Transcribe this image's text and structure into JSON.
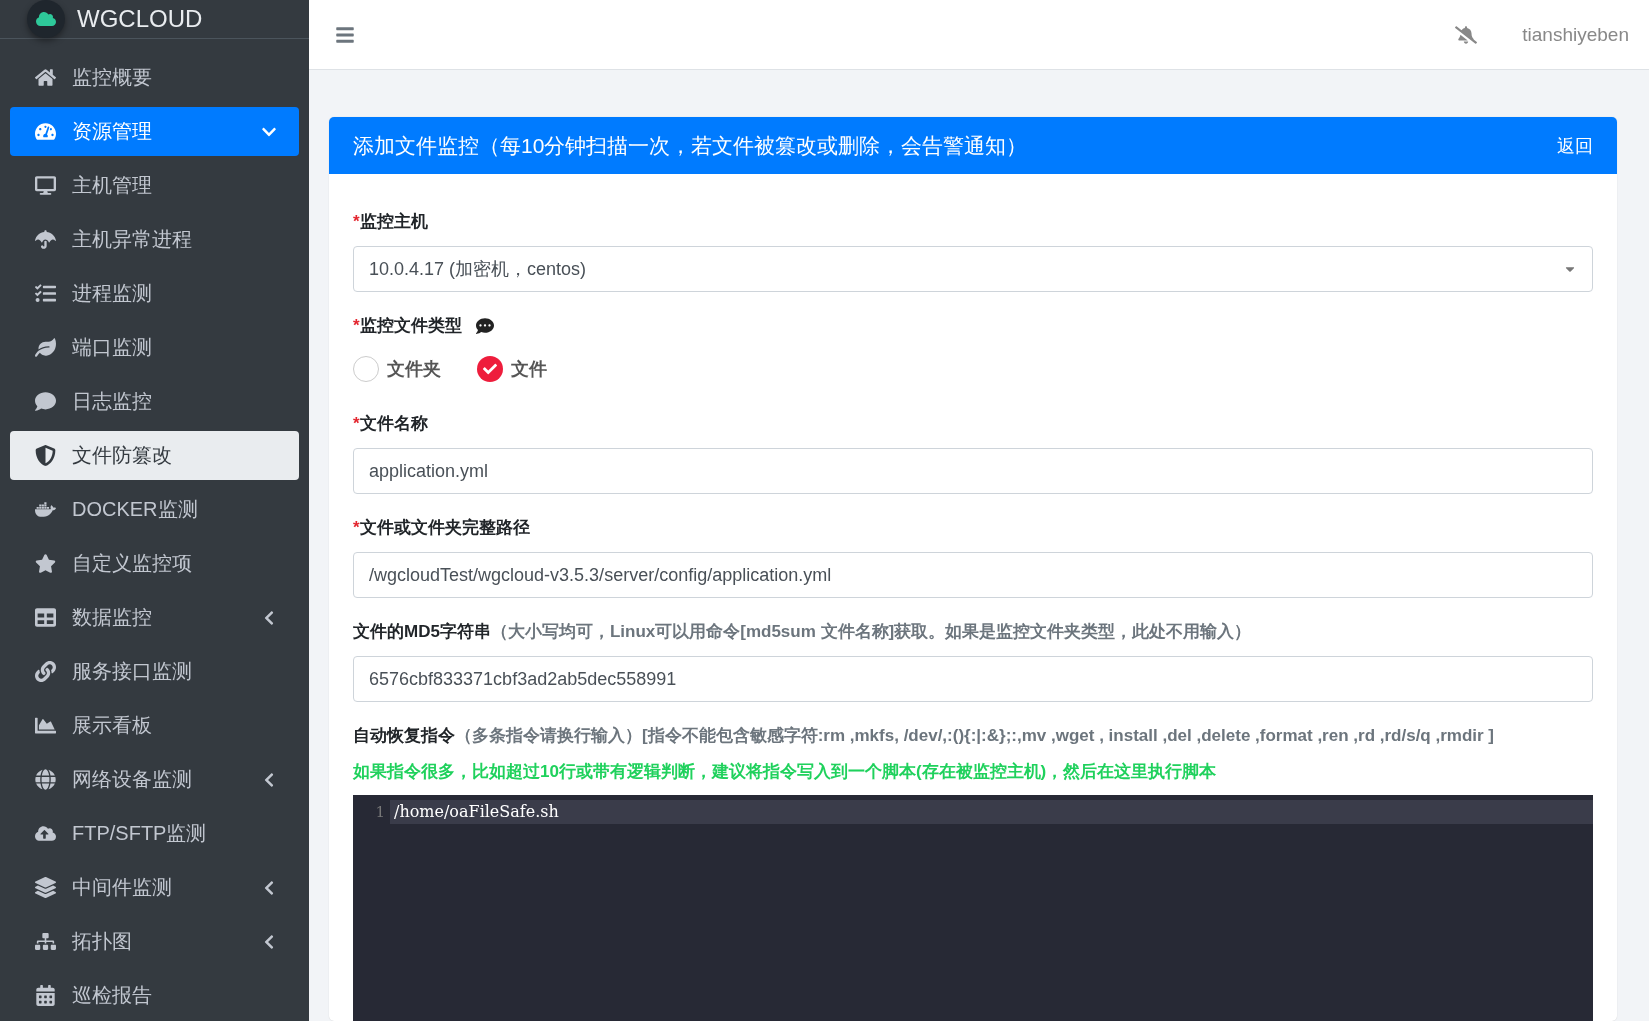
{
  "brand": {
    "name": "WGCLOUD"
  },
  "sidebar": {
    "items": [
      {
        "kind": "link",
        "label": "监控概要",
        "selected": false
      },
      {
        "kind": "group",
        "label": "资源管理",
        "selected": false,
        "expanded": true
      },
      {
        "kind": "link",
        "label": "主机管理",
        "selected": false
      },
      {
        "kind": "link",
        "label": "主机异常进程",
        "selected": false
      },
      {
        "kind": "link",
        "label": "进程监测",
        "selected": false
      },
      {
        "kind": "link",
        "label": "端口监测",
        "selected": false
      },
      {
        "kind": "link",
        "label": "日志监控",
        "selected": false
      },
      {
        "kind": "link",
        "label": "文件防篡改",
        "selected": true
      },
      {
        "kind": "link",
        "label": "DOCKER监测",
        "selected": false
      },
      {
        "kind": "link",
        "label": "自定义监控项",
        "selected": false
      },
      {
        "kind": "group",
        "label": "数据监控",
        "selected": false,
        "expanded": false
      },
      {
        "kind": "link",
        "label": "服务接口监测",
        "selected": false
      },
      {
        "kind": "link",
        "label": "展示看板",
        "selected": false
      },
      {
        "kind": "group",
        "label": "网络设备监测",
        "selected": false,
        "expanded": false
      },
      {
        "kind": "link",
        "label": "FTP/SFTP监测",
        "selected": false
      },
      {
        "kind": "group",
        "label": "中间件监测",
        "selected": false,
        "expanded": false
      },
      {
        "kind": "group",
        "label": "拓扑图",
        "selected": false,
        "expanded": false
      },
      {
        "kind": "link",
        "label": "巡检报告",
        "selected": false
      }
    ]
  },
  "topbar": {
    "user": "tianshiyeben"
  },
  "card": {
    "title": "添加文件监控（每10分钟扫描一次，若文件被篡改或删除，会告警通知）",
    "back": "返回",
    "fields": [
      {
        "kind": "select",
        "mark": "*",
        "label": "监控主机",
        "value": "10.0.4.17 (加密机，centos)"
      },
      {
        "kind": "radio",
        "mark": "*",
        "label": "监控文件类型",
        "options": [
          {
            "label": "文件夹",
            "selected": false
          },
          {
            "label": "文件",
            "selected": true
          }
        ]
      },
      {
        "kind": "input",
        "mark": "*",
        "label": "文件名称",
        "value": "application.yml"
      },
      {
        "kind": "input",
        "mark": "*",
        "label": "文件或文件夹完整路径",
        "value": "/wgcloudTest/wgcloud-v3.5.3/server/config/application.yml"
      },
      {
        "kind": "input",
        "label": "文件的MD5字符串",
        "hint": "（大小写均可，Linux可以用命令[md5sum 文件名称]获取。如果是监控文件夹类型，此处不用输入）",
        "value": "6576cbf833371cbf3ad2ab5dec558991"
      },
      {
        "kind": "code",
        "label": "自动恢复指令",
        "hint": "（多条指令请换行输入）[指令不能包含敏感字符:rm ,mkfs, /dev/,:(){:|:&};:,mv ,wget , install ,del ,delete ,format ,ren ,rd ,rd/s/q ,rmdir ]",
        "note": "如果指令很多，比如超过10行或带有逻辑判断，建议将指令写入到一个脚本(存在被监控主机)，然后在这里执行脚本",
        "lines": [
          {
            "number": "1",
            "text": "/home/oaFileSafe.sh"
          }
        ]
      }
    ]
  }
}
